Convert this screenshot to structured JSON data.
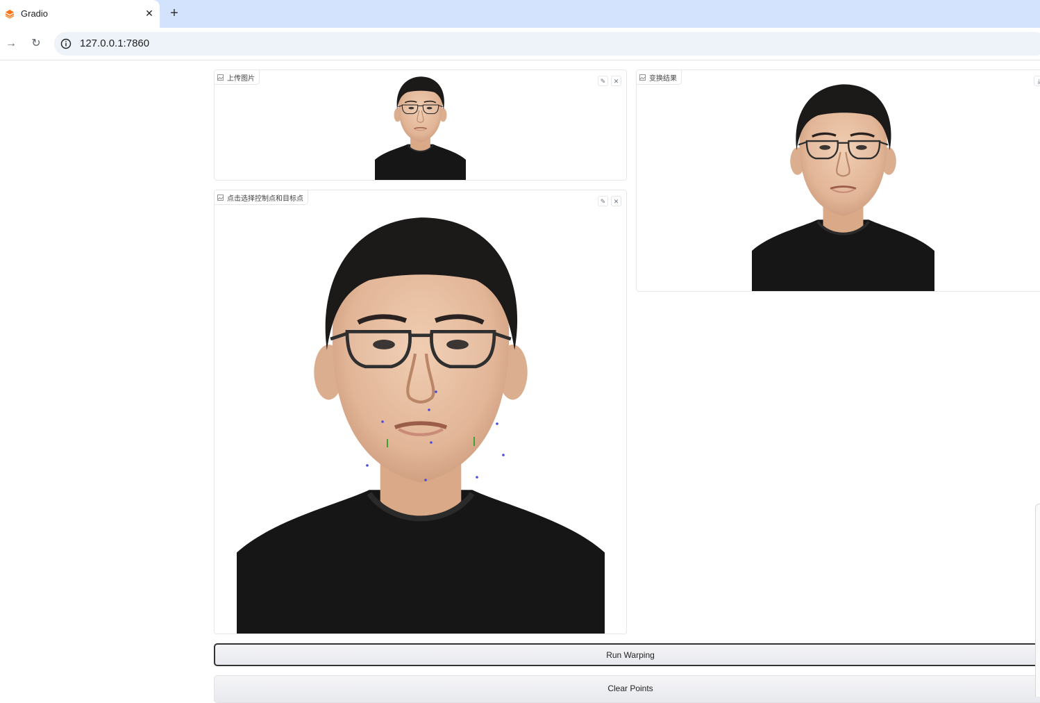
{
  "browser": {
    "tab_title": "Gradio",
    "url": "127.0.0.1:7860",
    "icons": [
      "gradio-favicon-icon",
      "close-icon",
      "plus-icon",
      "forward-icon",
      "reload-icon",
      "info-icon"
    ]
  },
  "panels": {
    "upload": {
      "label": "上传图片"
    },
    "select": {
      "label": "点击选择控制点和目标点"
    },
    "result": {
      "label": "变换结果"
    }
  },
  "buttons": {
    "run": "Run Warping",
    "clear": "Clear Points"
  },
  "colors": {
    "tabbar": "#d3e3fd",
    "shirt": "#161616",
    "skin": "#e8c0a2",
    "hair": "#1c1a19",
    "control_point": "#4a4adf",
    "target_marker": "#3aa335"
  }
}
